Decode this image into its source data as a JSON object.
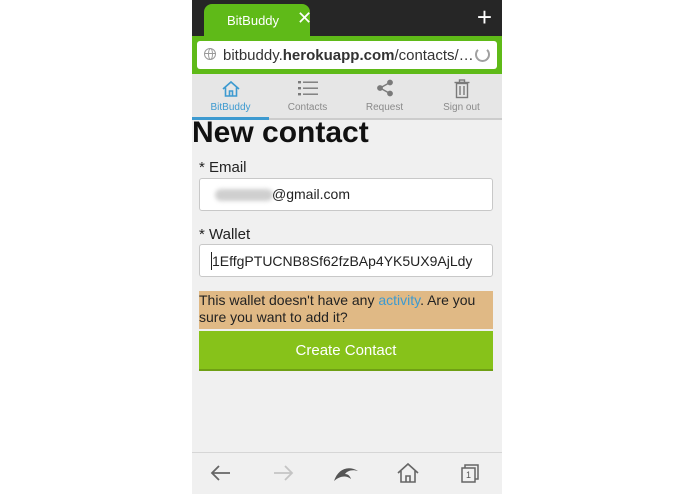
{
  "browser": {
    "tab_title": "BitBuddy",
    "tab_close": "✕",
    "new_tab": "+",
    "url_host_prefix": "bitbuddy.",
    "url_host_bold": "herokuapp.com",
    "url_path": "/contacts/…"
  },
  "nav": {
    "items": [
      {
        "label": "BitBuddy",
        "icon": "home-icon",
        "active": true
      },
      {
        "label": "Contacts",
        "icon": "list-icon",
        "active": false
      },
      {
        "label": "Request",
        "icon": "share-icon",
        "active": false
      },
      {
        "label": "Sign out",
        "icon": "trash-icon",
        "active": false
      }
    ]
  },
  "page": {
    "title": "New contact",
    "email_label": "* Email",
    "email_value_domain": "@gmail.com",
    "wallet_label": "* Wallet",
    "wallet_value": "1EffgPTUCNB8Sf62fzBAp4YK5UX9AjLdy",
    "warning_before": "This wallet doesn't have any ",
    "warning_link": "activity",
    "warning_after": ". Are you sure you want to add it?",
    "create_button": "Create Contact"
  },
  "bottom_bar": {
    "icons": [
      "back-icon",
      "forward-icon",
      "dolphin-icon",
      "home-icon",
      "tabs-icon"
    ],
    "tabs_count": "1"
  },
  "colors": {
    "browser_green": "#5fba18",
    "accent_blue": "#3d9ad0",
    "warning_bg": "#e0b985",
    "button_green": "#87c21a"
  }
}
